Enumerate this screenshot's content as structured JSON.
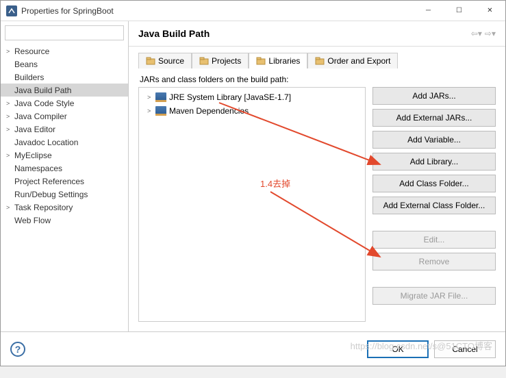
{
  "window": {
    "title": "Properties for SpringBoot"
  },
  "sidebar": {
    "filter_placeholder": "",
    "items": [
      {
        "label": "Resource",
        "expandable": true
      },
      {
        "label": "Beans"
      },
      {
        "label": "Builders"
      },
      {
        "label": "Java Build Path",
        "selected": true
      },
      {
        "label": "Java Code Style",
        "expandable": true
      },
      {
        "label": "Java Compiler",
        "expandable": true
      },
      {
        "label": "Java Editor",
        "expandable": true
      },
      {
        "label": "Javadoc Location"
      },
      {
        "label": "MyEclipse",
        "expandable": true
      },
      {
        "label": "Namespaces"
      },
      {
        "label": "Project References"
      },
      {
        "label": "Run/Debug Settings"
      },
      {
        "label": "Task Repository",
        "expandable": true
      },
      {
        "label": "Web Flow"
      }
    ]
  },
  "main": {
    "heading": "Java Build Path",
    "tabs": [
      {
        "label": "Source"
      },
      {
        "label": "Projects"
      },
      {
        "label": "Libraries",
        "active": true
      },
      {
        "label": "Order and Export"
      }
    ],
    "tab_desc": "JARs and class folders on the build path:",
    "jars": [
      {
        "label": "JRE System Library [JavaSE-1.7]"
      },
      {
        "label": "Maven Dependencies"
      }
    ],
    "buttons": {
      "add_jars": "Add JARs...",
      "add_ext_jars": "Add External JARs...",
      "add_var": "Add Variable...",
      "add_lib": "Add Library...",
      "add_class_folder": "Add Class Folder...",
      "add_ext_class_folder": "Add External Class Folder...",
      "edit": "Edit...",
      "remove": "Remove",
      "migrate": "Migrate JAR File..."
    }
  },
  "footer": {
    "ok": "OK",
    "cancel": "Cancel"
  },
  "annotation": {
    "text": "1.4去掉"
  },
  "watermark": "https://blog.csdn.net/s@51CTO博客"
}
